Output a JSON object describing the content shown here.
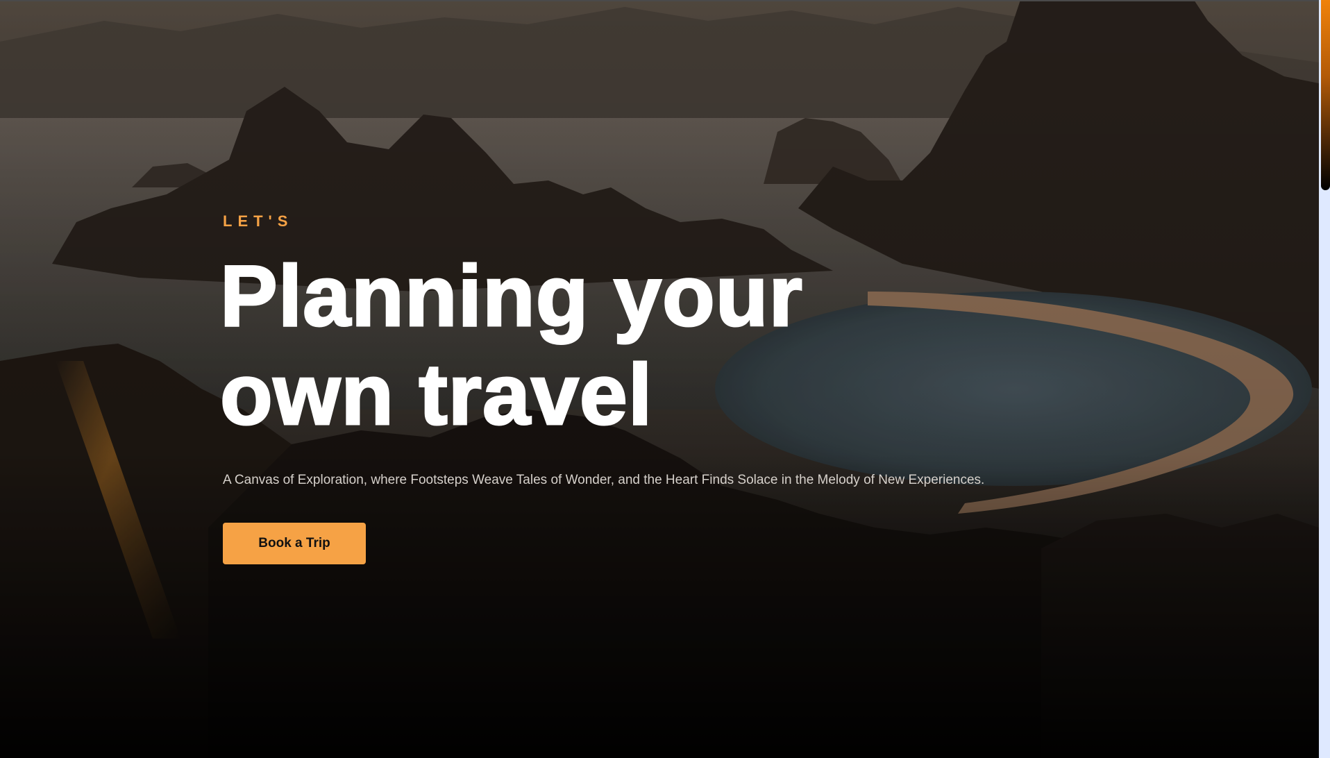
{
  "hero": {
    "eyebrow": "LET'S",
    "headline_line1": "Planning your",
    "headline_line2": "own travel",
    "subtitle": "A Canvas of Exploration, where Footsteps Weave Tales of Wonder, and the Heart Finds Solace in the Melody of New Experiences.",
    "cta_label": "Book a Trip"
  },
  "colors": {
    "accent": "#f6a245",
    "headline": "#ffffff",
    "subtitle": "#d6d1cb",
    "scrollbar_track": "#dfe9ff",
    "scrollbar_thumb": "#e07a10"
  },
  "background": {
    "icon": "mountain-lagoon-photo"
  }
}
